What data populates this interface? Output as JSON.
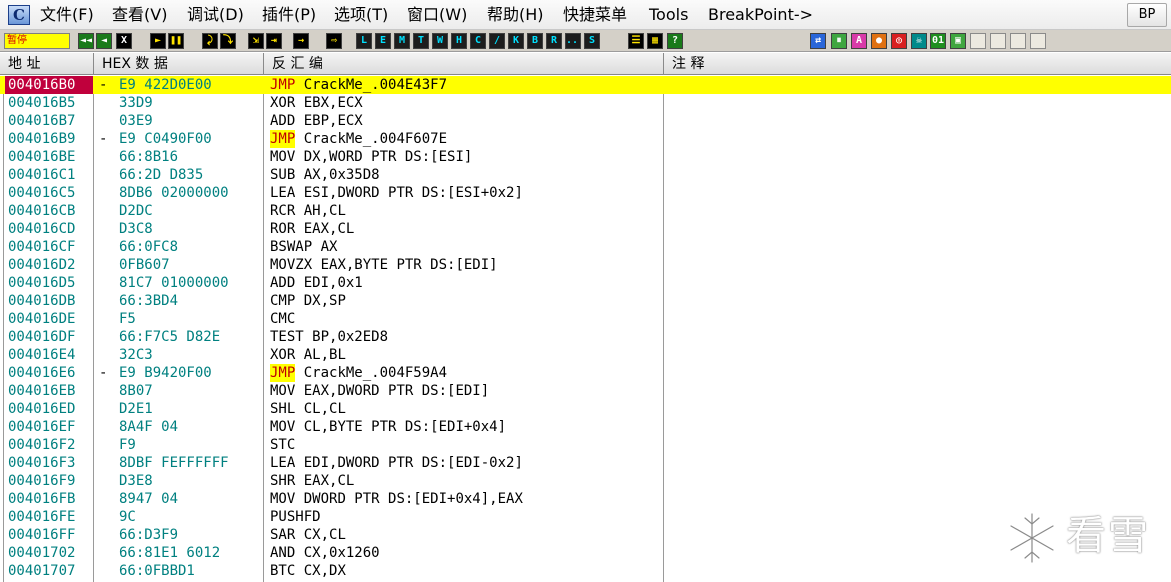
{
  "app": {
    "logo_letter": "C",
    "menu": [
      "文件(F)",
      "查看(V)",
      "调试(D)",
      "插件(P)",
      "选项(T)",
      "窗口(W)",
      "帮助(H)",
      "快捷菜单",
      "Tools",
      "BreakPoint->"
    ],
    "bp_button": "BP"
  },
  "toolbar": {
    "status": "暂停",
    "buttons": [
      "◄◄",
      "◄",
      "X",
      "►",
      "❚❚",
      "⤸",
      "⤵",
      "⇲",
      "⇥",
      "→",
      "⇨",
      "L",
      "E",
      "M",
      "T",
      "W",
      "H",
      "C",
      "/",
      "K",
      "B",
      "R",
      "...",
      "S",
      "☰",
      "▦",
      "?"
    ],
    "plugin_buttons": [
      "⇄",
      "⏸",
      "A",
      "●",
      "◎",
      "☠",
      "01",
      "▣"
    ]
  },
  "columns": {
    "address": "地 址",
    "hex": "HEX 数 据",
    "disasm": "反 汇 编",
    "comment": "注 释"
  },
  "rows": [
    {
      "addr": "004016B0",
      "mark": "-",
      "hex": "E9 422D0E00",
      "op": "JMP",
      "args": "CrackMe_.004E43F7"
    },
    {
      "addr": "004016B5",
      "mark": "",
      "hex": "33D9",
      "op": "XOR",
      "args": "EBX,ECX"
    },
    {
      "addr": "004016B7",
      "mark": "",
      "hex": "03E9",
      "op": "ADD",
      "args": "EBP,ECX"
    },
    {
      "addr": "004016B9",
      "mark": "-",
      "hex": "E9 C0490F00",
      "op": "JMP",
      "args": "CrackMe_.004F607E"
    },
    {
      "addr": "004016BE",
      "mark": "",
      "hex": "66:8B16",
      "op": "MOV",
      "args": "DX,WORD PTR DS:[ESI]"
    },
    {
      "addr": "004016C1",
      "mark": "",
      "hex": "66:2D D835",
      "op": "SUB",
      "args": "AX,0x35D8"
    },
    {
      "addr": "004016C5",
      "mark": "",
      "hex": "8DB6 02000000",
      "op": "LEA",
      "args": "ESI,DWORD PTR DS:[ESI+0x2]"
    },
    {
      "addr": "004016CB",
      "mark": "",
      "hex": "D2DC",
      "op": "RCR",
      "args": "AH,CL"
    },
    {
      "addr": "004016CD",
      "mark": "",
      "hex": "D3C8",
      "op": "ROR",
      "args": "EAX,CL"
    },
    {
      "addr": "004016CF",
      "mark": "",
      "hex": "66:0FC8",
      "op": "BSWAP",
      "args": "AX"
    },
    {
      "addr": "004016D2",
      "mark": "",
      "hex": "0FB607",
      "op": "MOVZX",
      "args": "EAX,BYTE PTR DS:[EDI]"
    },
    {
      "addr": "004016D5",
      "mark": "",
      "hex": "81C7 01000000",
      "op": "ADD",
      "args": "EDI,0x1"
    },
    {
      "addr": "004016DB",
      "mark": "",
      "hex": "66:3BD4",
      "op": "CMP",
      "args": "DX,SP"
    },
    {
      "addr": "004016DE",
      "mark": "",
      "hex": "F5",
      "op": "CMC",
      "args": ""
    },
    {
      "addr": "004016DF",
      "mark": "",
      "hex": "66:F7C5 D82E",
      "op": "TEST",
      "args": "BP,0x2ED8"
    },
    {
      "addr": "004016E4",
      "mark": "",
      "hex": "32C3",
      "op": "XOR",
      "args": "AL,BL"
    },
    {
      "addr": "004016E6",
      "mark": "-",
      "hex": "E9 B9420F00",
      "op": "JMP",
      "args": "CrackMe_.004F59A4"
    },
    {
      "addr": "004016EB",
      "mark": "",
      "hex": "8B07",
      "op": "MOV",
      "args": "EAX,DWORD PTR DS:[EDI]"
    },
    {
      "addr": "004016ED",
      "mark": "",
      "hex": "D2E1",
      "op": "SHL",
      "args": "CL,CL"
    },
    {
      "addr": "004016EF",
      "mark": "",
      "hex": "8A4F 04",
      "op": "MOV",
      "args": "CL,BYTE PTR DS:[EDI+0x4]"
    },
    {
      "addr": "004016F2",
      "mark": "",
      "hex": "F9",
      "op": "STC",
      "args": ""
    },
    {
      "addr": "004016F3",
      "mark": "",
      "hex": "8DBF FEFFFFFF",
      "op": "LEA",
      "args": "EDI,DWORD PTR DS:[EDI-0x2]"
    },
    {
      "addr": "004016F9",
      "mark": "",
      "hex": "D3E8",
      "op": "SHR",
      "args": "EAX,CL"
    },
    {
      "addr": "004016FB",
      "mark": "",
      "hex": "8947 04",
      "op": "MOV",
      "args": "DWORD PTR DS:[EDI+0x4],EAX"
    },
    {
      "addr": "004016FE",
      "mark": "",
      "hex": "9C",
      "op": "PUSHFD",
      "args": ""
    },
    {
      "addr": "004016FF",
      "mark": "",
      "hex": "66:D3F9",
      "op": "SAR",
      "args": "CX,CL"
    },
    {
      "addr": "00401702",
      "mark": "",
      "hex": "66:81E1 6012",
      "op": "AND",
      "args": "CX,0x1260"
    },
    {
      "addr": "00401707",
      "mark": "",
      "hex": "66:0FBBD1",
      "op": "BTC",
      "args": "CX,DX"
    }
  ],
  "selected_row": 0,
  "watermark": "看雪",
  "colors": {
    "selection": "#ffff00",
    "selected_address": "#c0003c",
    "address_text": "#008080",
    "jump_text": "#c00000"
  }
}
